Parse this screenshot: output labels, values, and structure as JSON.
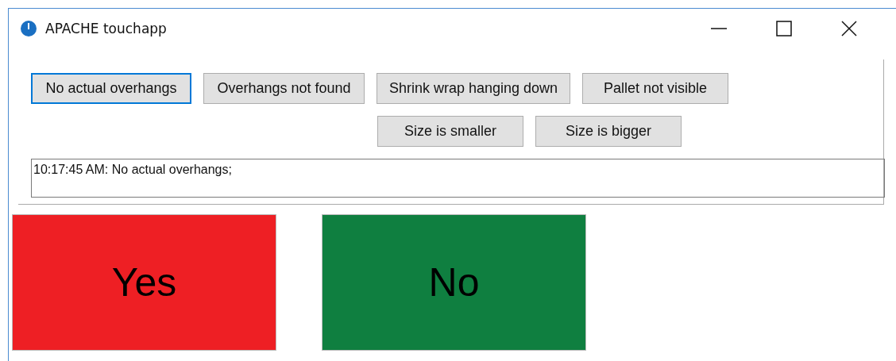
{
  "window": {
    "title": "APACHE touchapp"
  },
  "reason_buttons": [
    {
      "label": "No actual overhangs",
      "focused": true
    },
    {
      "label": "Overhangs not found",
      "focused": false
    },
    {
      "label": "Shrink wrap hanging down",
      "focused": false
    },
    {
      "label": "Pallet not visible",
      "focused": false
    }
  ],
  "size_buttons": [
    {
      "label": "Size is smaller",
      "focused": false
    },
    {
      "label": "Size is bigger",
      "focused": false
    }
  ],
  "log": {
    "value": "10:17:45 AM: No actual overhangs;"
  },
  "answer_buttons": [
    {
      "label": "Yes",
      "color": "#ee1f24"
    },
    {
      "label": "No",
      "color": "#0f7f40"
    }
  ]
}
